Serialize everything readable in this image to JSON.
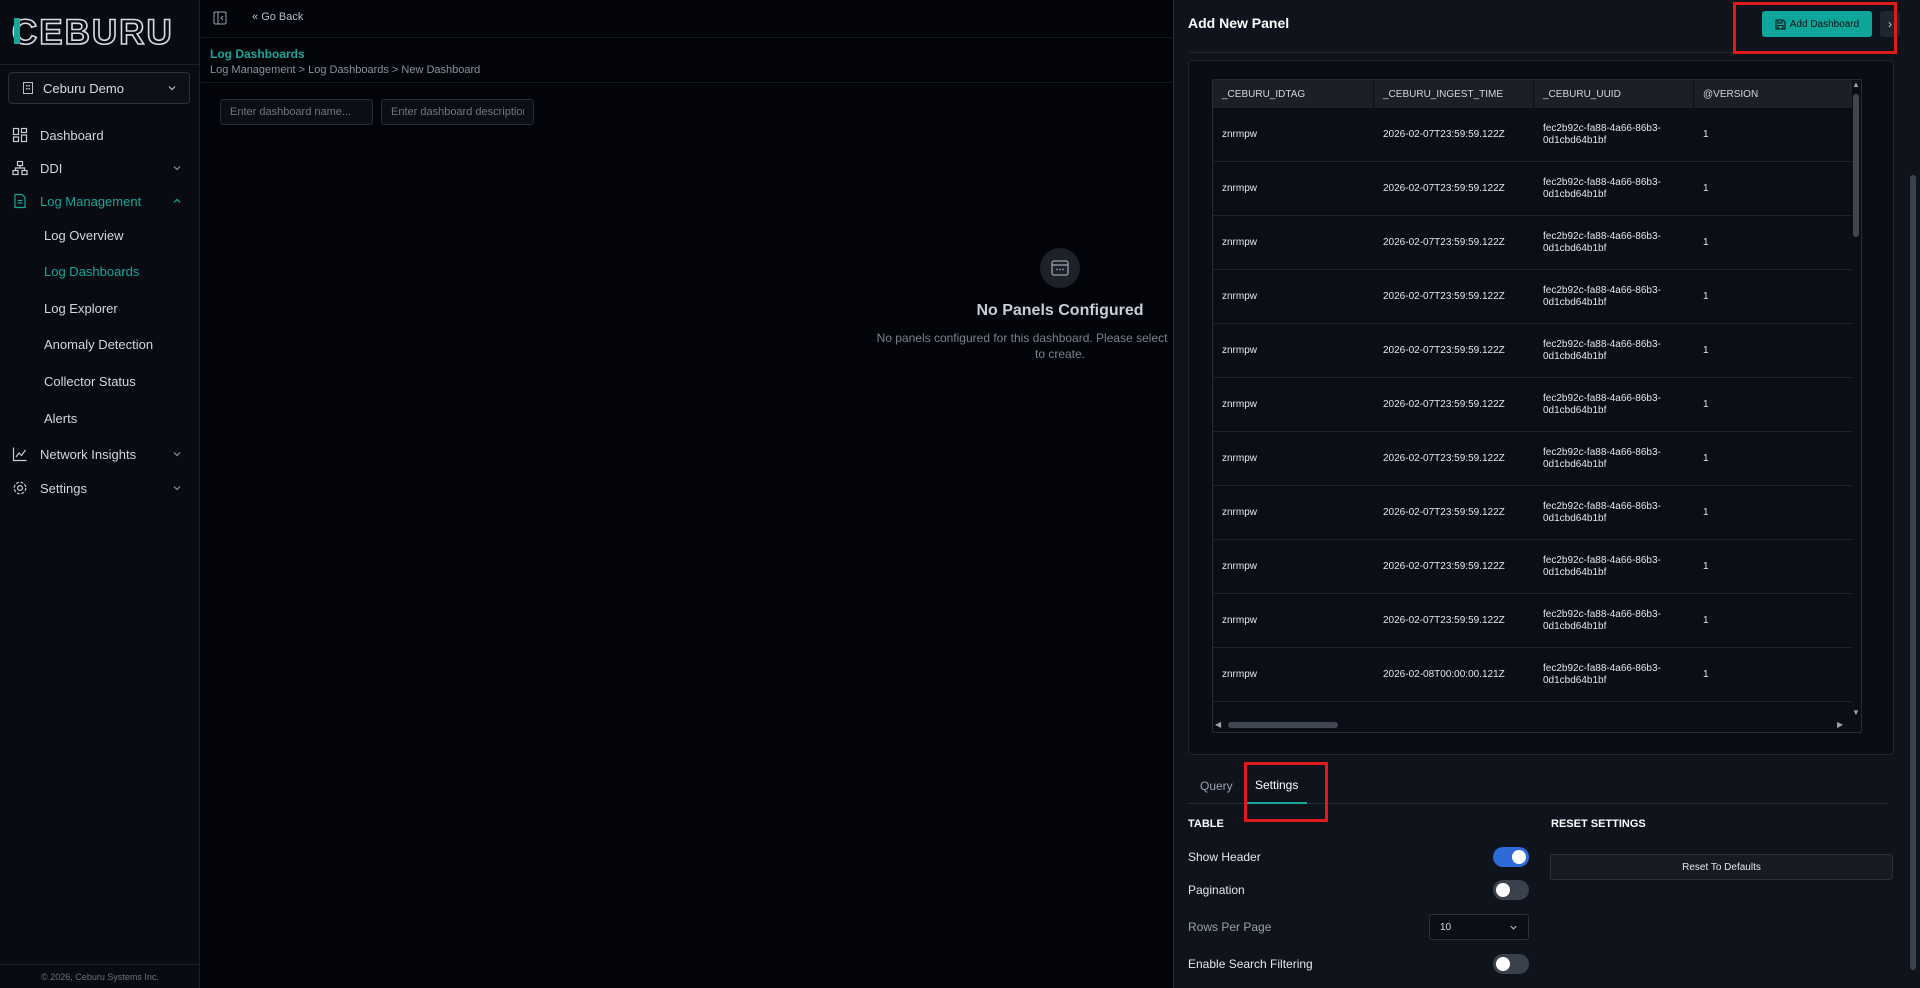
{
  "brand": {
    "logo_text": "CEBURU"
  },
  "org_selector": {
    "value": "Ceburu Demo"
  },
  "sidebar": {
    "items": [
      {
        "label": "Dashboard",
        "icon": "dashboard-icon"
      },
      {
        "label": "DDI",
        "icon": "network-icon"
      },
      {
        "label": "Log Management",
        "icon": "document-icon"
      },
      {
        "label": "Network Insights",
        "icon": "chart-icon"
      },
      {
        "label": "Settings",
        "icon": "gear-icon"
      }
    ],
    "sub_items": [
      "Log Overview",
      "Log Dashboards",
      "Log Explorer",
      "Anomaly Detection",
      "Collector Status",
      "Alerts"
    ],
    "footer": "© 2026, Ceburu Systems Inc."
  },
  "header": {
    "go_back": "Go Back",
    "title": "Log Dashboards",
    "breadcrumb": "Log Management > Log Dashboards > New Dashboard"
  },
  "dashboard_form": {
    "name_placeholder": "Enter dashboard name...",
    "desc_placeholder": "Enter dashboard description"
  },
  "empty_state": {
    "title": "No Panels Configured",
    "desc_line1": "No panels configured for this dashboard. Please select",
    "desc_line2": "to create."
  },
  "drawer": {
    "title": "Add New Panel",
    "add_button": "Add Dashboard",
    "close_glyph": "›",
    "table": {
      "columns": [
        "_CEBURU_IDTAG",
        "_CEBURU_INGEST_TIME",
        "_CEBURU_UUID",
        "@VERSION"
      ],
      "rows": [
        [
          "znrmpw",
          "2026-02-07T23:59:59.122Z",
          "fec2b92c-fa88-4a66-86b3-",
          "0d1cbd64b1bf",
          "1"
        ],
        [
          "znrmpw",
          "2026-02-07T23:59:59.122Z",
          "fec2b92c-fa88-4a66-86b3-",
          "0d1cbd64b1bf",
          "1"
        ],
        [
          "znrmpw",
          "2026-02-07T23:59:59.122Z",
          "fec2b92c-fa88-4a66-86b3-",
          "0d1cbd64b1bf",
          "1"
        ],
        [
          "znrmpw",
          "2026-02-07T23:59:59.122Z",
          "fec2b92c-fa88-4a66-86b3-",
          "0d1cbd64b1bf",
          "1"
        ],
        [
          "znrmpw",
          "2026-02-07T23:59:59.122Z",
          "fec2b92c-fa88-4a66-86b3-",
          "0d1cbd64b1bf",
          "1"
        ],
        [
          "znrmpw",
          "2026-02-07T23:59:59.122Z",
          "fec2b92c-fa88-4a66-86b3-",
          "0d1cbd64b1bf",
          "1"
        ],
        [
          "znrmpw",
          "2026-02-07T23:59:59.122Z",
          "fec2b92c-fa88-4a66-86b3-",
          "0d1cbd64b1bf",
          "1"
        ],
        [
          "znrmpw",
          "2026-02-07T23:59:59.122Z",
          "fec2b92c-fa88-4a66-86b3-",
          "0d1cbd64b1bf",
          "1"
        ],
        [
          "znrmpw",
          "2026-02-07T23:59:59.122Z",
          "fec2b92c-fa88-4a66-86b3-",
          "0d1cbd64b1bf",
          "1"
        ],
        [
          "znrmpw",
          "2026-02-07T23:59:59.122Z",
          "fec2b92c-fa88-4a66-86b3-",
          "0d1cbd64b1bf",
          "1"
        ],
        [
          "znrmpw",
          "2026-02-08T00:00:00.121Z",
          "fec2b92c-fa88-4a66-86b3-",
          "0d1cbd64b1bf",
          "1"
        ]
      ]
    },
    "tabs": [
      "Query",
      "Settings"
    ],
    "active_tab": "Settings",
    "settings": {
      "table_section": "TABLE",
      "reset_section": "RESET SETTINGS",
      "show_header": "Show Header",
      "show_header_on": true,
      "pagination": "Pagination",
      "pagination_on": false,
      "rows_per_page": "Rows Per Page",
      "rows_per_page_value": "10",
      "enable_search": "Enable Search Filtering",
      "enable_search_on": false,
      "reset_button": "Reset To Defaults"
    }
  },
  "colors": {
    "accent": "#19a598",
    "button": "#0ea59a",
    "toggle_on": "#2f6bd8",
    "highlight": "#e01b1b",
    "background": "#020409"
  }
}
